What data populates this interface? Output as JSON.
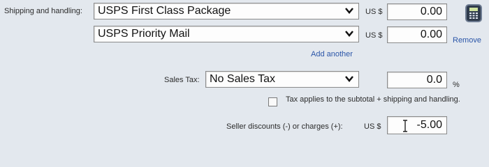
{
  "shipping": {
    "label": "Shipping and handling:",
    "service1": "USPS First Class Package",
    "currency1": "US $",
    "amount1": "0.00",
    "service2": "USPS Priority Mail",
    "currency2": "US $",
    "amount2": "0.00",
    "remove_label": "Remove",
    "add_another_label": "Add another"
  },
  "sales_tax": {
    "label": "Sales Tax:",
    "selected": "No Sales Tax",
    "rate": "0.0",
    "percent_symbol": "%"
  },
  "tax_applies": {
    "label": "Tax applies to the subtotal + shipping and handling.",
    "checked": false
  },
  "discounts": {
    "label": "Seller discounts (-) or charges (+):",
    "currency": "US $",
    "value": "-5.00"
  },
  "icons": {
    "calculator": "calculator-icon",
    "chevron": "chevron-down-icon",
    "cursor": "text-cursor-icon"
  }
}
